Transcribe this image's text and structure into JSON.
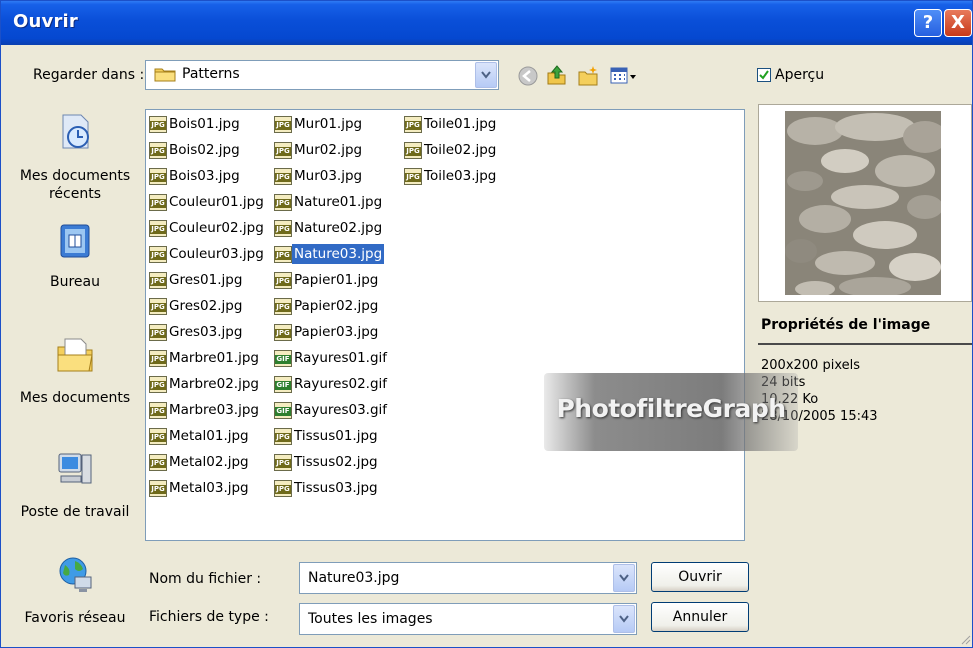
{
  "window": {
    "title": "Ouvrir",
    "help_glyph": "?",
    "close_glyph": "X"
  },
  "lookin": {
    "label": "Regarder dans :",
    "value": "Patterns"
  },
  "preview": {
    "checkbox_label": "Aperçu",
    "checked": true
  },
  "places": [
    {
      "label": "Mes documents récents"
    },
    {
      "label": "Bureau"
    },
    {
      "label": "Mes documents"
    },
    {
      "label": "Poste de travail"
    },
    {
      "label": "Favoris réseau"
    }
  ],
  "files": {
    "col1": [
      "Bois01.jpg",
      "Bois02.jpg",
      "Bois03.jpg",
      "Couleur01.jpg",
      "Couleur02.jpg",
      "Couleur03.jpg",
      "Gres01.jpg",
      "Gres02.jpg",
      "Gres03.jpg",
      "Marbre01.jpg",
      "Marbre02.jpg",
      "Marbre03.jpg",
      "Metal01.jpg",
      "Metal02.jpg",
      "Metal03.jpg"
    ],
    "col2": [
      "Mur01.jpg",
      "Mur02.jpg",
      "Mur03.jpg",
      "Nature01.jpg",
      "Nature02.jpg",
      "Nature03.jpg",
      "Papier01.jpg",
      "Papier02.jpg",
      "Papier03.jpg",
      "Rayures01.gif",
      "Rayures02.gif",
      "Rayures03.gif",
      "Tissus01.jpg",
      "Tissus02.jpg",
      "Tissus03.jpg"
    ],
    "col3": [
      "Toile01.jpg",
      "Toile02.jpg",
      "Toile03.jpg"
    ],
    "selected": "Nature03.jpg",
    "jpg_badge": "JPG",
    "gif_badge": "GIF"
  },
  "properties": {
    "title": "Propriétés de l'image",
    "dimensions": "200x200 pixels",
    "depth": "24 bits",
    "size": "10,22 Ko",
    "date": "28/10/2005 15:43"
  },
  "filename": {
    "label": "Nom du fichier :",
    "value": "Nature03.jpg"
  },
  "filetype": {
    "label": "Fichiers de type :",
    "value": "Toutes les images"
  },
  "buttons": {
    "open": "Ouvrir",
    "cancel": "Annuler"
  },
  "watermark": "PhotofiltreGraph"
}
